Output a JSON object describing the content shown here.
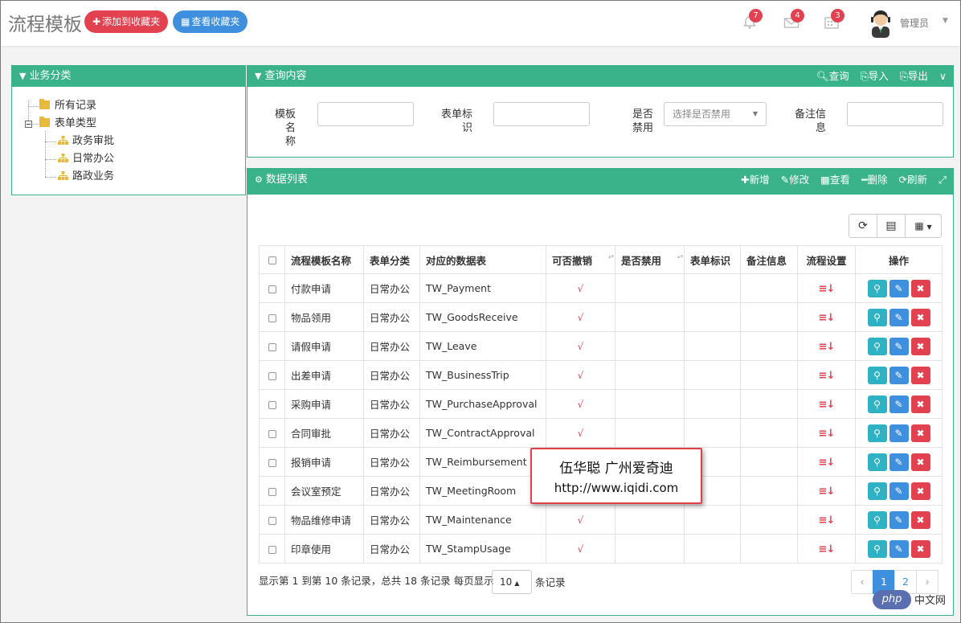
{
  "header": {
    "title": "流程模板",
    "add_fav": "添加到收藏夹",
    "view_fav": "查看收藏夹",
    "notifications": [
      {
        "icon": "bell-icon",
        "count": "7"
      },
      {
        "icon": "mail-icon",
        "count": "4"
      },
      {
        "icon": "calendar-icon",
        "count": "3"
      }
    ],
    "user": "管理员"
  },
  "tree": {
    "title": "业务分类",
    "nodes": [
      "所有记录",
      "表单类型",
      "政务审批",
      "日常办公",
      "路政业务"
    ]
  },
  "query": {
    "title": "查询内容",
    "actions": [
      "查询",
      "导入",
      "导出"
    ],
    "fields": {
      "name_label_1": "模板名",
      "name_label_2": "称",
      "form_label_1": "表单标",
      "form_label_2": "识",
      "disabled_label_1": "是否",
      "disabled_label_2": "禁用",
      "disabled_placeholder": "选择是否禁用",
      "remark_label_1": "备注信",
      "remark_label_2": "息"
    }
  },
  "list": {
    "title": "数据列表",
    "actions": [
      "新增",
      "修改",
      "查看",
      "删除",
      "刷新"
    ],
    "columns": [
      "流程模板名称",
      "表单分类",
      "对应的数据表",
      "可否撤销",
      "是否禁用",
      "表单标识",
      "备注信息",
      "流程设置",
      "操作"
    ],
    "rows": [
      {
        "name": "付款申请",
        "category": "日常办公",
        "table": "TW_Payment",
        "revocable": "√"
      },
      {
        "name": "物品领用",
        "category": "日常办公",
        "table": "TW_GoodsReceive",
        "revocable": "√"
      },
      {
        "name": "请假申请",
        "category": "日常办公",
        "table": "TW_Leave",
        "revocable": "√"
      },
      {
        "name": "出差申请",
        "category": "日常办公",
        "table": "TW_BusinessTrip",
        "revocable": "√"
      },
      {
        "name": "采购申请",
        "category": "日常办公",
        "table": "TW_PurchaseApproval",
        "revocable": "√"
      },
      {
        "name": "合同审批",
        "category": "日常办公",
        "table": "TW_ContractApproval",
        "revocable": "√"
      },
      {
        "name": "报销申请",
        "category": "日常办公",
        "table": "TW_Reimbursement",
        "revocable": ""
      },
      {
        "name": "会议室预定",
        "category": "日常办公",
        "table": "TW_MeetingRoom",
        "revocable": ""
      },
      {
        "name": "物品维修申请",
        "category": "日常办公",
        "table": "TW_Maintenance",
        "revocable": "√"
      },
      {
        "name": "印章使用",
        "category": "日常办公",
        "table": "TW_StampUsage",
        "revocable": "√"
      }
    ],
    "flow_icon": "≡↓",
    "pagination": {
      "info": "显示第 1 到第 10 条记录，总共 18 条记录 每页显示",
      "page_size": "10",
      "suffix": "条记录",
      "prev": "‹",
      "pages": [
        "1",
        "2"
      ],
      "next": "›"
    }
  },
  "watermark": {
    "line1": "伍华聪 广州爱奇迪",
    "line2": "http://www.iqidi.com",
    "logo_text": "php",
    "logo_cn": "中文网"
  }
}
